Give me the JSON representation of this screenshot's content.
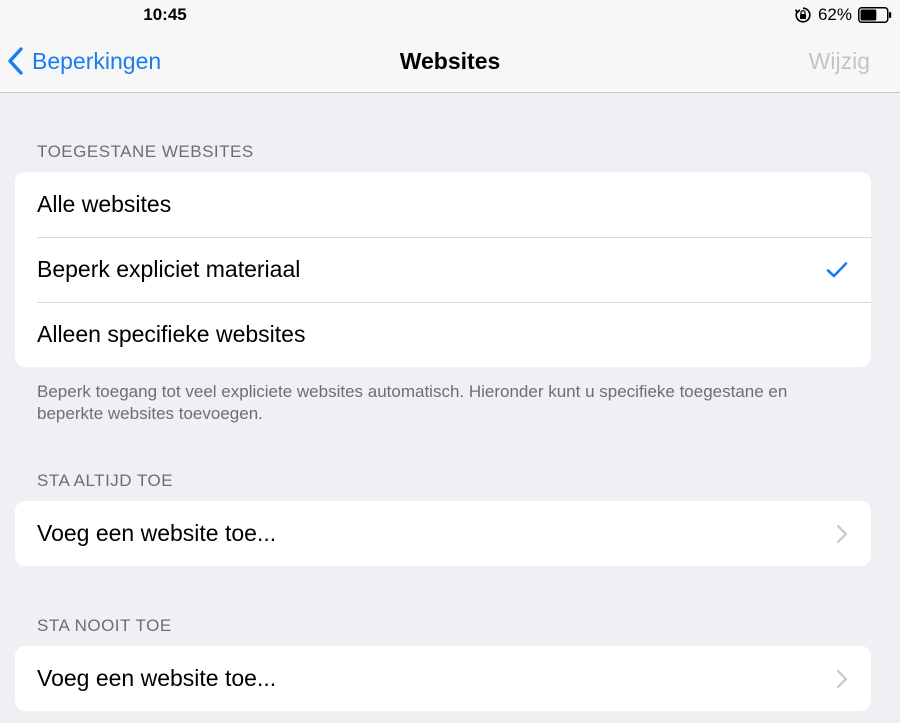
{
  "status_bar": {
    "time": "10:45",
    "battery_percent": "62%",
    "battery_level": 0.62,
    "icons": [
      "orientation-lock-icon",
      "battery-icon"
    ]
  },
  "nav": {
    "back_label": "Beperkingen",
    "title": "Websites",
    "edit_label": "Wijzig",
    "colors": {
      "accent": "#1a7cf5",
      "disabled": "#c4c4c9"
    }
  },
  "sections": {
    "allowed": {
      "header": "TOEGESTANE WEBSITES",
      "items": [
        {
          "label": "Alle websites",
          "selected": false
        },
        {
          "label": "Beperk expliciet materiaal",
          "selected": true
        },
        {
          "label": "Alleen specifieke websites",
          "selected": false
        }
      ],
      "footer": "Beperk toegang tot veel expliciete websites automatisch. Hieronder kunt u specifieke toegestane en beperkte websites toevoegen."
    },
    "always_allow": {
      "header": "STA ALTIJD TOE",
      "add_label": "Voeg een website toe..."
    },
    "never_allow": {
      "header": "STA NOOIT TOE",
      "add_label": "Voeg een website toe..."
    }
  }
}
